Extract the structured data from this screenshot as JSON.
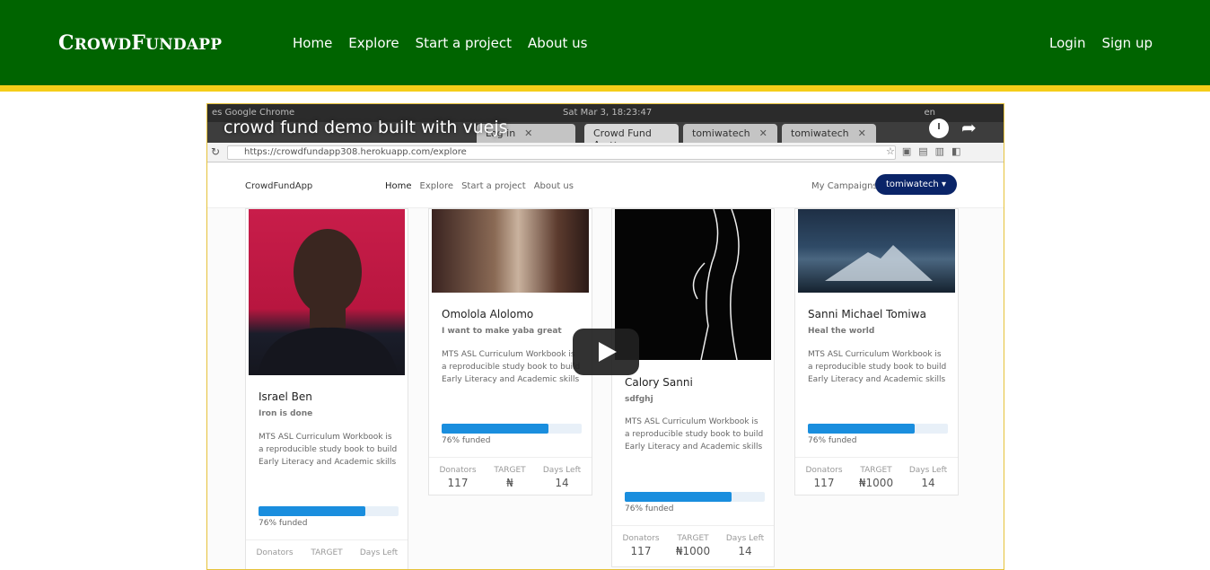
{
  "header": {
    "brand_first": "C",
    "brand_rest1": "ROWD",
    "brand_mid": "F",
    "brand_rest2": "UND",
    "brand_end": "APP",
    "nav": [
      "Home",
      "Explore",
      "Start a project",
      "About us"
    ],
    "auth": [
      "Login",
      "Sign up"
    ],
    "colors": {
      "bar": "#006400",
      "stripe": "#f5cd19"
    }
  },
  "video": {
    "title": "crowd fund demo built with vuejs",
    "os_bar": {
      "left": "es   Google Chrome",
      "center": "Sat Mar  3, 18:23:47",
      "right": "en"
    },
    "tabs": [
      "Log in",
      "Crowd Fund A",
      "tomiwatech",
      "tomiwatech"
    ],
    "url": "https://crowdfundapp308.herokuapp.com/explore",
    "app_nav": {
      "brand": "CrowdFundApp",
      "links": [
        "Home",
        "Explore",
        "Start a project",
        "About us"
      ],
      "my_campaigns": "My Campaigns",
      "user": "tomiwatech ▾"
    },
    "cards": [
      {
        "name": "Israel Ben",
        "tagline": "Iron is done",
        "description": "MTS ASL Curriculum Workbook is a reproducible study book to build Early Literacy and Academic skills",
        "funded_pct": 0.76,
        "funded_label": "76% funded",
        "stats": {
          "donators_label": "Donators",
          "donators": "",
          "target_label": "TARGET",
          "target": "",
          "days_label": "Days Left",
          "days": ""
        }
      },
      {
        "name": "Omolola Alolomo",
        "tagline": "I want to make yaba great",
        "description": "MTS ASL Curriculum Workbook is a reproducible study book to build Early Literacy and Academic skills",
        "funded_pct": 0.76,
        "funded_label": "76% funded",
        "stats": {
          "donators_label": "Donators",
          "donators": "117",
          "target_label": "TARGET",
          "target": "₦",
          "days_label": "Days Left",
          "days": "14"
        }
      },
      {
        "name": "Calory Sanni",
        "tagline": "sdfghj",
        "description": "MTS ASL Curriculum Workbook is a reproducible study book to build Early Literacy and Academic skills",
        "funded_pct": 0.76,
        "funded_label": "76% funded",
        "stats": {
          "donators_label": "Donators",
          "donators": "117",
          "target_label": "TARGET",
          "target": "₦1000",
          "days_label": "Days Left",
          "days": "14"
        }
      },
      {
        "name": "Sanni Michael Tomiwa",
        "tagline": "Heal the world",
        "description": "MTS ASL Curriculum Workbook is a reproducible study book to build Early Literacy and Academic skills",
        "funded_pct": 0.76,
        "funded_label": "76% funded",
        "stats": {
          "donators_label": "Donators",
          "donators": "117",
          "target_label": "TARGET",
          "target": "₦1000",
          "days_label": "Days Left",
          "days": "14"
        }
      }
    ]
  }
}
